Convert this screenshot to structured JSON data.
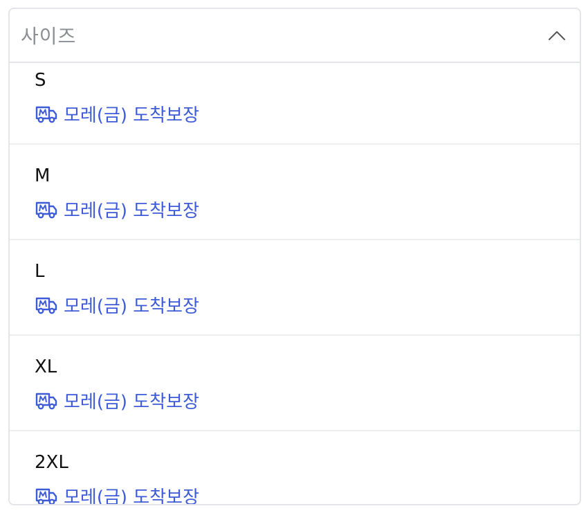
{
  "dropdown": {
    "label": "사이즈",
    "expanded": true,
    "chevron_icon": "chevron-up-icon",
    "options": [
      {
        "size": "S",
        "delivery": "모레(금) 도착보장",
        "icon": "truck-icon"
      },
      {
        "size": "M",
        "delivery": "모레(금) 도착보장",
        "icon": "truck-icon"
      },
      {
        "size": "L",
        "delivery": "모레(금) 도착보장",
        "icon": "truck-icon"
      },
      {
        "size": "XL",
        "delivery": "모레(금) 도착보장",
        "icon": "truck-icon"
      },
      {
        "size": "2XL",
        "delivery": "모레(금) 도착보장",
        "icon": "truck-icon"
      }
    ]
  },
  "colors": {
    "accent": "#3d5bd9",
    "label_gray": "#8a8d91",
    "border": "#e3e5e8"
  }
}
